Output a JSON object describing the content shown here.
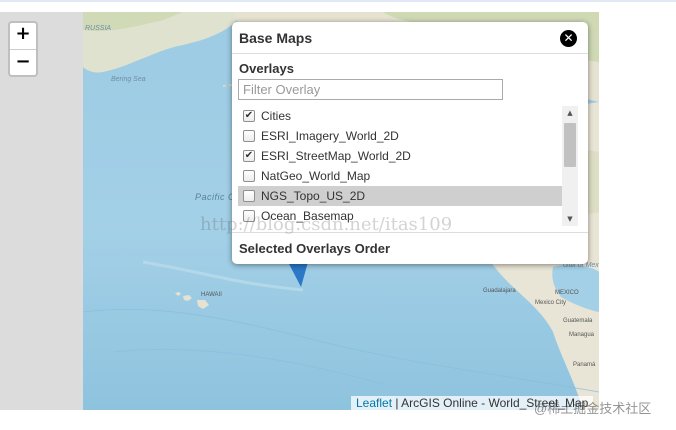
{
  "zoom": {
    "in_label": "+",
    "out_label": "−"
  },
  "map": {
    "labels": {
      "russia": "RUSSIA",
      "bering_sea": "Bering Sea",
      "pacific_ocean": "Pacific O",
      "hawaii": "HAWAII",
      "gulf_of_mexico": "Gulf of Mex",
      "mexico": "MEXICO",
      "guadalajara": "Guadalajara",
      "mexico_city": "Mexico City",
      "guatemala": "Guatemala",
      "managua": "Managua",
      "panama": "Panamá"
    },
    "colors": {
      "water": "#9ccbe3",
      "land": "#e9e5d6",
      "forest": "#c9d7ad"
    }
  },
  "panel": {
    "title": "Base Maps",
    "close_icon": "close-circle-icon",
    "overlays_title": "Overlays",
    "filter_placeholder": "Filter Overlay",
    "overlays": [
      {
        "label": "Cities",
        "checked": true
      },
      {
        "label": "ESRI_Imagery_World_2D",
        "checked": false
      },
      {
        "label": "ESRI_StreetMap_World_2D",
        "checked": true
      },
      {
        "label": "NatGeo_World_Map",
        "checked": false
      },
      {
        "label": "NGS_Topo_US_2D",
        "checked": false
      },
      {
        "label": "Ocean_Basemap",
        "checked": false
      }
    ],
    "selected_order_title": "Selected Overlays Order"
  },
  "attribution": {
    "link": "Leaflet",
    "text": " | ArcGIS Online - World_Street_Map"
  },
  "watermark": "http://blog.csdn.net/itas109",
  "corner_mark": "@稀土掘金技术社区"
}
